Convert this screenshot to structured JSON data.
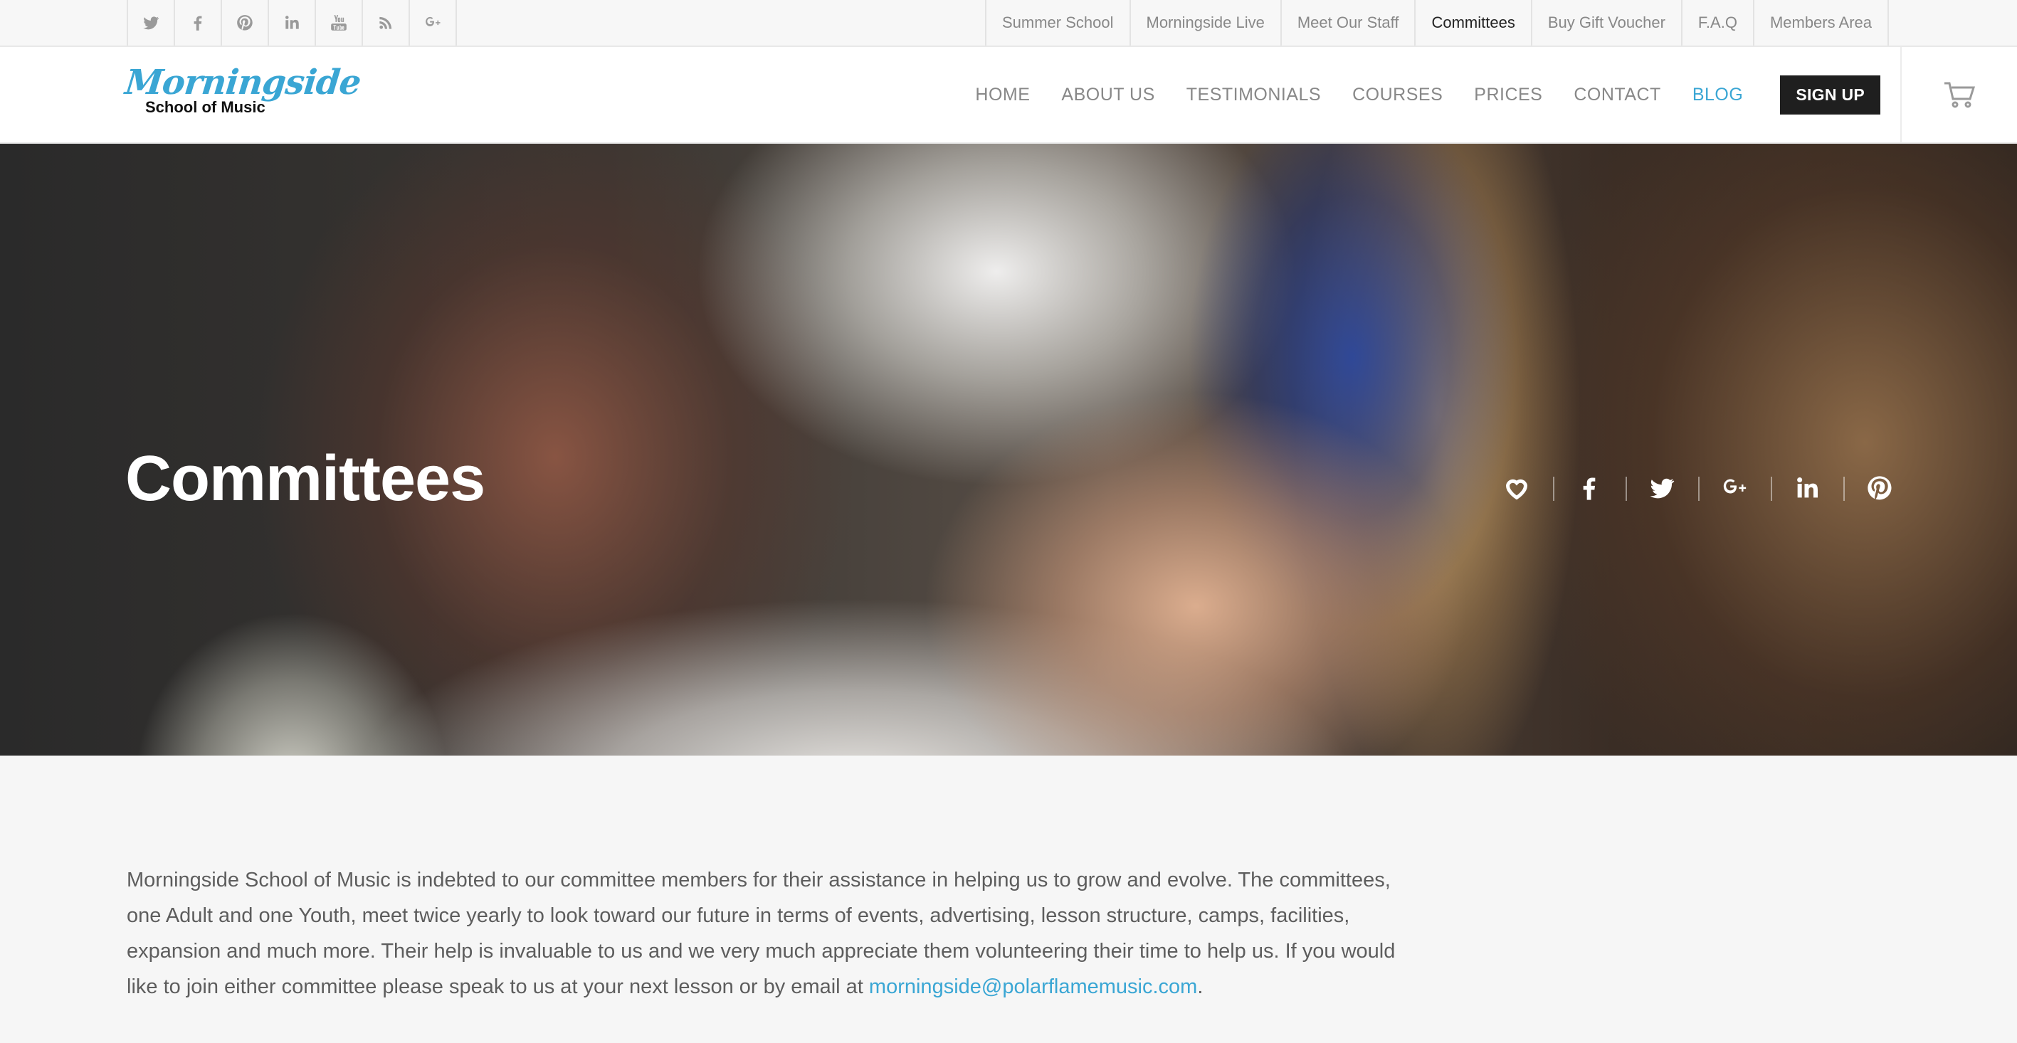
{
  "topbar": {
    "social_icons": [
      "twitter-icon",
      "facebook-icon",
      "pinterest-icon",
      "linkedin-icon",
      "youtube-icon",
      "rss-icon",
      "google-plus-icon"
    ],
    "links": [
      {
        "label": "Summer School",
        "active": false
      },
      {
        "label": "Morningside Live",
        "active": false
      },
      {
        "label": "Meet Our Staff",
        "active": false
      },
      {
        "label": "Committees",
        "active": true
      },
      {
        "label": "Buy Gift Voucher",
        "active": false
      },
      {
        "label": "F.A.Q",
        "active": false
      },
      {
        "label": "Members Area",
        "active": false
      }
    ]
  },
  "header": {
    "logo": {
      "script": "Morningside",
      "subtitle": "School of Music"
    },
    "nav": [
      "HOME",
      "ABOUT US",
      "TESTIMONIALS",
      "COURSES",
      "PRICES",
      "CONTACT",
      "BLOG"
    ],
    "signup_label": "SIGN UP",
    "cart_icon": "cart-icon"
  },
  "hero": {
    "title": "Committees",
    "share_icons": [
      "heart-icon",
      "facebook-icon",
      "twitter-icon",
      "google-plus-icon",
      "linkedin-icon",
      "pinterest-icon"
    ]
  },
  "content": {
    "paragraph": "Morningside School of Music is indebted to our committee members for their assistance in helping us to grow and evolve.  The committees, one Adult and one Youth, meet twice yearly to look toward our future in terms of events, advertising, lesson structure, camps, facilities, expansion and much more. Their help is invaluable to us and we very much appreciate them volunteering their time to help us.  If you would like to join either committee please speak to us at your next lesson or by email at ",
    "email": "morningside@polarflamemusic.com",
    "trailing": "."
  },
  "colors": {
    "accent": "#3aa6d4",
    "signup_bg": "#1f1f1f",
    "text": "#5d5d5d"
  }
}
